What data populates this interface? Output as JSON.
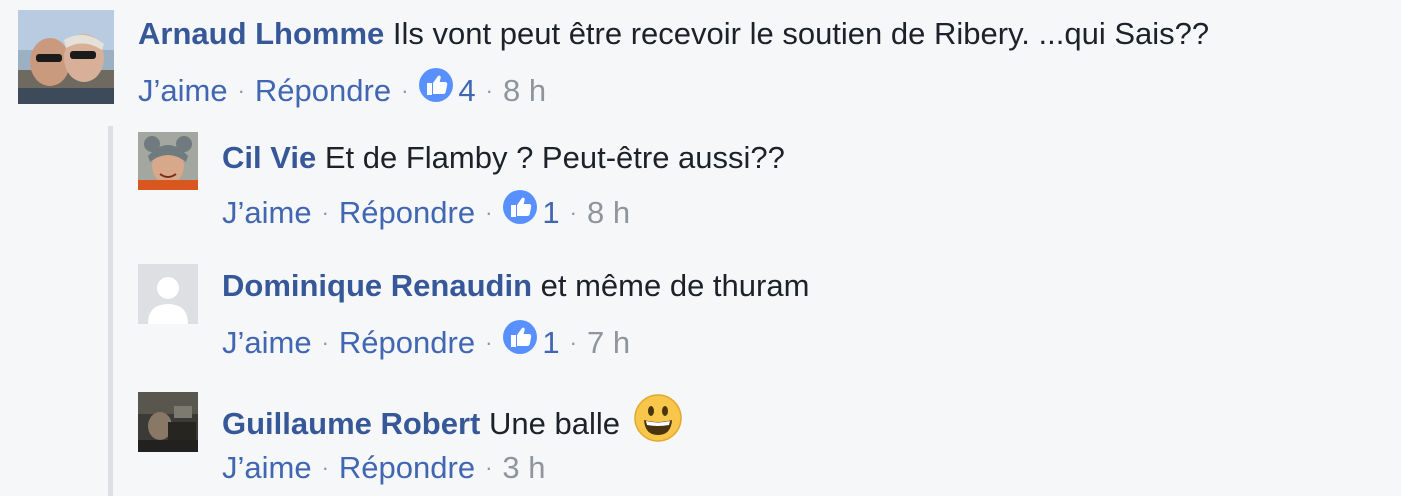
{
  "comments": [
    {
      "author": "Arnaud Lhomme",
      "text": "Ils vont peut être recevoir le soutien de Ribery. ...qui Sais??",
      "like_label": "J’aime",
      "reply_label": "Répondre",
      "separator": "·",
      "reactions": "4",
      "time": "8 h"
    }
  ],
  "replies": [
    {
      "author": "Cil Vie",
      "text": "Et de Flamby ? Peut-être aussi??",
      "like_label": "J’aime",
      "reply_label": "Répondre",
      "separator": "·",
      "reactions": "1",
      "time": "8 h"
    },
    {
      "author": "Dominique Renaudin",
      "text": "et même de thuram",
      "like_label": "J’aime",
      "reply_label": "Répondre",
      "separator": "·",
      "reactions": "1",
      "time": "7 h"
    },
    {
      "author": "Guillaume Robert",
      "text": "Une balle",
      "emoji": "grinning-face-emoji",
      "like_label": "J’aime",
      "reply_label": "Répondre",
      "separator": "·",
      "time": "3 h"
    }
  ],
  "colors": {
    "background": "#f6f7f9",
    "author": "#365899",
    "link": "#4267b2",
    "meta": "#90949c",
    "like_badge": "#5890ff"
  }
}
